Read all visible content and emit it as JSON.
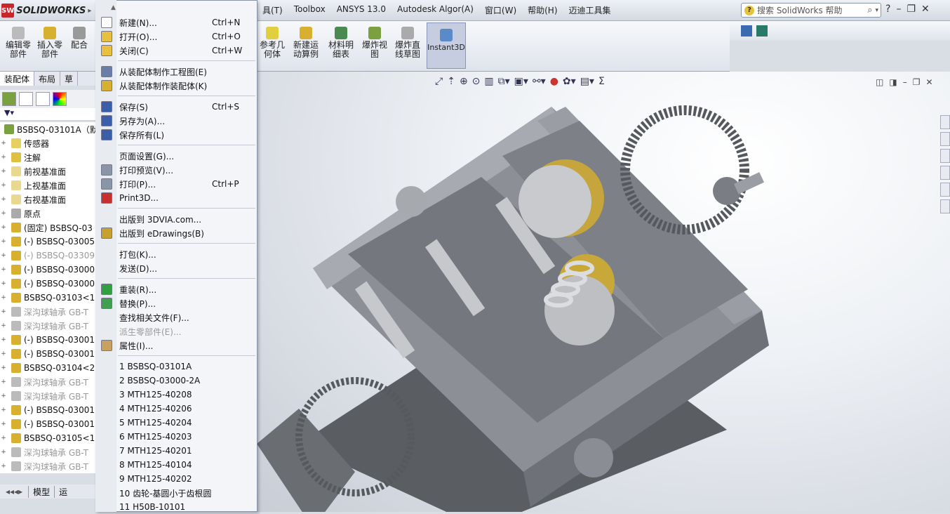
{
  "app": {
    "name": "SOLIDWORKS",
    "logo_mark": "SW"
  },
  "menubar": [
    "具(T)",
    "Toolbox",
    "ANSYS 13.0",
    "Autodesk Algor(A)",
    "窗口(W)",
    "帮助(H)",
    "迈迪工具集"
  ],
  "search": {
    "placeholder": "搜索 SolidWorks 帮助"
  },
  "toolbar": {
    "edit_part": "编辑零部件",
    "insert_part": "插入零部件",
    "mate": "配合",
    "ref_geometry": "参考几何体",
    "new_motion": "新建运动算例",
    "bom": "材料明细表",
    "exploded_view": "爆炸视图",
    "exploded_sketch": "爆炸直线草图",
    "instant3d": "Instant3D"
  },
  "left_tabs": [
    "装配体",
    "布局",
    "草"
  ],
  "tree": [
    {
      "label": "BSBSQ-03101A（默",
      "dim": false,
      "icon": "assembly-icon"
    },
    {
      "label": "传感器",
      "dim": false,
      "icon": "sensor-icon"
    },
    {
      "label": "注解",
      "dim": false,
      "icon": "annotation-icon"
    },
    {
      "label": "前视基准面",
      "dim": false,
      "icon": "plane-icon"
    },
    {
      "label": "上视基准面",
      "dim": false,
      "icon": "plane-icon"
    },
    {
      "label": "右视基准面",
      "dim": false,
      "icon": "plane-icon"
    },
    {
      "label": "原点",
      "dim": false,
      "icon": "origin-icon"
    },
    {
      "label": "(固定) BSBSQ-03",
      "dim": false,
      "icon": "part-icon"
    },
    {
      "label": "(-) BSBSQ-03005",
      "dim": false,
      "icon": "part-icon"
    },
    {
      "label": "(-) BSBSQ-03309",
      "dim": true,
      "icon": "part-icon"
    },
    {
      "label": "(-) BSBSQ-03000",
      "dim": false,
      "icon": "part-icon"
    },
    {
      "label": "(-) BSBSQ-03000",
      "dim": false,
      "icon": "part-icon"
    },
    {
      "label": "BSBSQ-03103<1",
      "dim": false,
      "icon": "subassembly-icon"
    },
    {
      "label": "深沟球轴承 GB-T",
      "dim": true,
      "icon": "bearing-icon"
    },
    {
      "label": "深沟球轴承 GB-T",
      "dim": true,
      "icon": "bearing-icon"
    },
    {
      "label": "(-) BSBSQ-03001",
      "dim": false,
      "icon": "part-icon"
    },
    {
      "label": "(-) BSBSQ-03001",
      "dim": false,
      "icon": "part-icon"
    },
    {
      "label": "BSBSQ-03104<2",
      "dim": false,
      "icon": "subassembly-icon"
    },
    {
      "label": "深沟球轴承 GB-T",
      "dim": true,
      "icon": "bearing-icon"
    },
    {
      "label": "深沟球轴承 GB-T",
      "dim": true,
      "icon": "bearing-icon"
    },
    {
      "label": "(-) BSBSQ-03001",
      "dim": false,
      "icon": "part-icon"
    },
    {
      "label": "(-) BSBSQ-03001",
      "dim": false,
      "icon": "part-icon"
    },
    {
      "label": "BSBSQ-03105<1",
      "dim": false,
      "icon": "subassembly-icon"
    },
    {
      "label": "深沟球轴承 GB-T",
      "dim": true,
      "icon": "bearing-icon"
    },
    {
      "label": "深沟球轴承 GB-T",
      "dim": true,
      "icon": "bearing-icon"
    }
  ],
  "bottom_tabs": [
    "模型",
    "运"
  ],
  "file_menu": [
    {
      "label": "新建(N)...",
      "shortcut": "Ctrl+N",
      "icon": "new-icon",
      "color": "#ffffff"
    },
    {
      "label": "打开(O)...",
      "shortcut": "Ctrl+O",
      "icon": "open-icon",
      "color": "#e8c040"
    },
    {
      "label": "关闭(C)",
      "shortcut": "Ctrl+W",
      "icon": "close-file-icon",
      "color": "#e8c040"
    },
    {
      "sep": true
    },
    {
      "label": "从装配体制作工程图(E)",
      "shortcut": "",
      "icon": "drawing-icon",
      "color": "#6a7fa8"
    },
    {
      "label": "从装配体制作装配体(K)",
      "shortcut": "",
      "icon": "assembly-icon",
      "color": "#d8b030"
    },
    {
      "sep": true
    },
    {
      "label": "保存(S)",
      "shortcut": "Ctrl+S",
      "icon": "save-icon",
      "color": "#3a5fa8"
    },
    {
      "label": "另存为(A)...",
      "shortcut": "",
      "icon": "save-as-icon",
      "color": "#3a5fa8"
    },
    {
      "label": "保存所有(L)",
      "shortcut": "",
      "icon": "save-all-icon",
      "color": "#3a5fa8"
    },
    {
      "sep": true
    },
    {
      "label": "页面设置(G)...",
      "shortcut": "",
      "icon": "",
      "color": ""
    },
    {
      "label": "打印预览(V)...",
      "shortcut": "",
      "icon": "print-preview-icon",
      "color": "#8a95a8"
    },
    {
      "label": "打印(P)...",
      "shortcut": "Ctrl+P",
      "icon": "print-icon",
      "color": "#8a95a8"
    },
    {
      "label": "Print3D...",
      "shortcut": "",
      "icon": "print3d-icon",
      "color": "#c83030"
    },
    {
      "sep": true
    },
    {
      "label": "出版到 3DVIA.com...",
      "shortcut": "",
      "icon": "",
      "color": ""
    },
    {
      "label": "出版到 eDrawings(B)",
      "shortcut": "",
      "icon": "edrawings-icon",
      "color": "#c8a030"
    },
    {
      "sep": true
    },
    {
      "label": "打包(K)...",
      "shortcut": "",
      "icon": "",
      "color": ""
    },
    {
      "label": "发送(D)...",
      "shortcut": "",
      "icon": "",
      "color": ""
    },
    {
      "sep": true
    },
    {
      "label": "重装(R)...",
      "shortcut": "",
      "icon": "reload-icon",
      "color": "#30a040"
    },
    {
      "label": "替换(P)...",
      "shortcut": "",
      "icon": "replace-icon",
      "color": "#40a050"
    },
    {
      "label": "查找相关文件(F)...",
      "shortcut": "",
      "icon": "",
      "color": ""
    },
    {
      "label": "派生零部件(E)...",
      "shortcut": "",
      "icon": "",
      "color": "",
      "dis": true
    },
    {
      "label": "属性(I)...",
      "shortcut": "",
      "icon": "properties-icon",
      "color": "#c8a060"
    },
    {
      "sep": true
    },
    {
      "label": "1 BSBSQ-03101A",
      "shortcut": "",
      "icon": "",
      "color": ""
    },
    {
      "label": "2 BSBSQ-03000-2A",
      "shortcut": "",
      "icon": "",
      "color": ""
    },
    {
      "label": "3 MTH125-40208",
      "shortcut": "",
      "icon": "",
      "color": ""
    },
    {
      "label": "4 MTH125-40206",
      "shortcut": "",
      "icon": "",
      "color": ""
    },
    {
      "label": "5 MTH125-40204",
      "shortcut": "",
      "icon": "",
      "color": ""
    },
    {
      "label": "6 MTH125-40203",
      "shortcut": "",
      "icon": "",
      "color": ""
    },
    {
      "label": "7 MTH125-40201",
      "shortcut": "",
      "icon": "",
      "color": ""
    },
    {
      "label": "8 MTH125-40104",
      "shortcut": "",
      "icon": "",
      "color": ""
    },
    {
      "label": "9 MTH125-40202",
      "shortcut": "",
      "icon": "",
      "color": ""
    },
    {
      "label": "10 齿轮-基圆小于齿根圆",
      "shortcut": "",
      "icon": "",
      "color": ""
    },
    {
      "label": "11 H50B-10101",
      "shortcut": "",
      "icon": "",
      "color": ""
    }
  ]
}
